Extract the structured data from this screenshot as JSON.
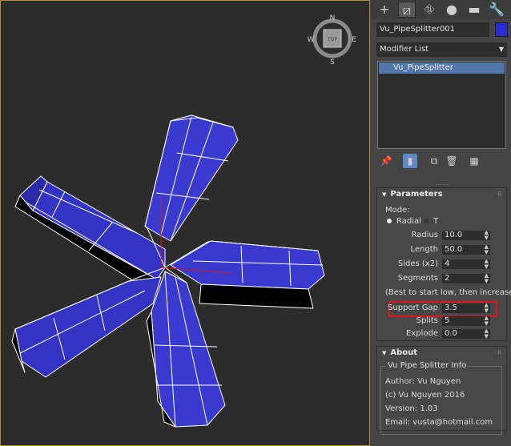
{
  "viewport": {
    "compass": {
      "north": "N",
      "south": "S",
      "east": "E",
      "west": "W"
    },
    "viewcube_label": "TOP"
  },
  "command_panel": {
    "tabs": [
      {
        "name": "create-tab",
        "icon": "plus-icon",
        "glyph": "+"
      },
      {
        "name": "modify-tab",
        "icon": "modify-icon",
        "glyph": "⧄"
      },
      {
        "name": "hierarchy-tab",
        "icon": "hierarchy-icon",
        "glyph": "⛗"
      },
      {
        "name": "motion-tab",
        "icon": "motion-icon",
        "glyph": "●"
      },
      {
        "name": "display-tab",
        "icon": "display-icon",
        "glyph": "▬"
      },
      {
        "name": "utilities-tab",
        "icon": "wrench-icon",
        "glyph": "🔧"
      }
    ],
    "object_name": "Vu_PipeSplitter001",
    "object_color": "#2b2bd6",
    "modifier_list_label": "Modifier List",
    "modifier_stack": [
      "Vu_PipeSplitter"
    ]
  },
  "parameters": {
    "title": "Parameters",
    "mode_label": "Mode:",
    "mode_radial": "Radial",
    "mode_t": "T",
    "radius_label": "Radius",
    "radius_value": "10.0",
    "length_label": "Length",
    "length_value": "50.0",
    "sides_label": "Sides (x2)",
    "sides_value": "4",
    "segments_label": "Segments",
    "segments_value": "2",
    "hint": "(Best to start low, then increase)",
    "support_gap_label": "Support Gap",
    "support_gap_value": "3.5",
    "splits_label": "Splits",
    "splits_value": "5",
    "explode_label": "Explode",
    "explode_value": "0.0"
  },
  "about": {
    "title": "About",
    "group_label": "Vu Pipe Splitter Info",
    "author": "Author: Vu Nguyen",
    "copyright": "(c) Vu Nguyen 2016",
    "version": "Version: 1.03",
    "email": "Email: vusta@hotmail.com"
  }
}
